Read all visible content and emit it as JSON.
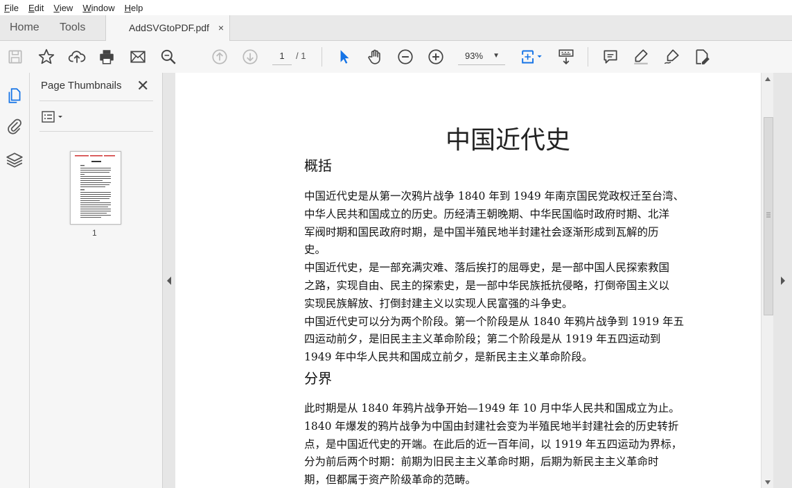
{
  "menu": [
    "File",
    "Edit",
    "View",
    "Window",
    "Help"
  ],
  "tabs": {
    "home": "Home",
    "tools": "Tools",
    "document": "AddSVGtoPDF.pdf",
    "close": "×"
  },
  "toolbar": {
    "page_current": "1",
    "page_total": "/ 1",
    "zoom": "93%"
  },
  "panel": {
    "title": "Page Thumbnails",
    "close": "✕",
    "thumb_label": "1"
  },
  "document": {
    "title": "中国近代史",
    "sections": [
      {
        "heading": "概括",
        "lines": [
          "中国近代史是从第一次鸦片战争 1840 年到 1949 年南京国民党政权迁至台湾、",
          "中华人民共和国成立的历史。历经清王朝晚期、中华民国临时政府时期、北洋",
          "军阀时期和国民政府时期，是中国半殖民地半封建社会逐渐形成到瓦解的历",
          "史。",
          "中国近代史，是一部充满灾难、落后挨打的屈辱史，是一部中国人民探索救国",
          "之路，实现自由、民主的探索史，是一部中华民族抵抗侵略，打倒帝国主义以",
          "实现民族解放、打倒封建主义以实现人民富强的斗争史。",
          "中国近代史可以分为两个阶段。第一个阶段是从 1840 年鸦片战争到 1919 年五",
          "四运动前夕，是旧民主主义革命阶段；第二个阶段是从 1919 年五四运动到",
          "1949 年中华人民共和国成立前夕，是新民主主义革命阶段。"
        ]
      },
      {
        "heading": "分界",
        "lines": [
          "此时期是从 1840 年鸦片战争开始—1949 年 10 月中华人民共和国成立为止。",
          "1840 年爆发的鸦片战争为中国由封建社会变为半殖民地半封建社会的历史转折",
          "点，是中国近代史的开端。在此后的近一百年间，以 1919 年五四运动为界标，",
          "分为前后两个时期：前期为旧民主主义革命时期，后期为新民主主义革命时",
          "期，但都属于资产阶级革命的范畴。"
        ]
      }
    ]
  }
}
